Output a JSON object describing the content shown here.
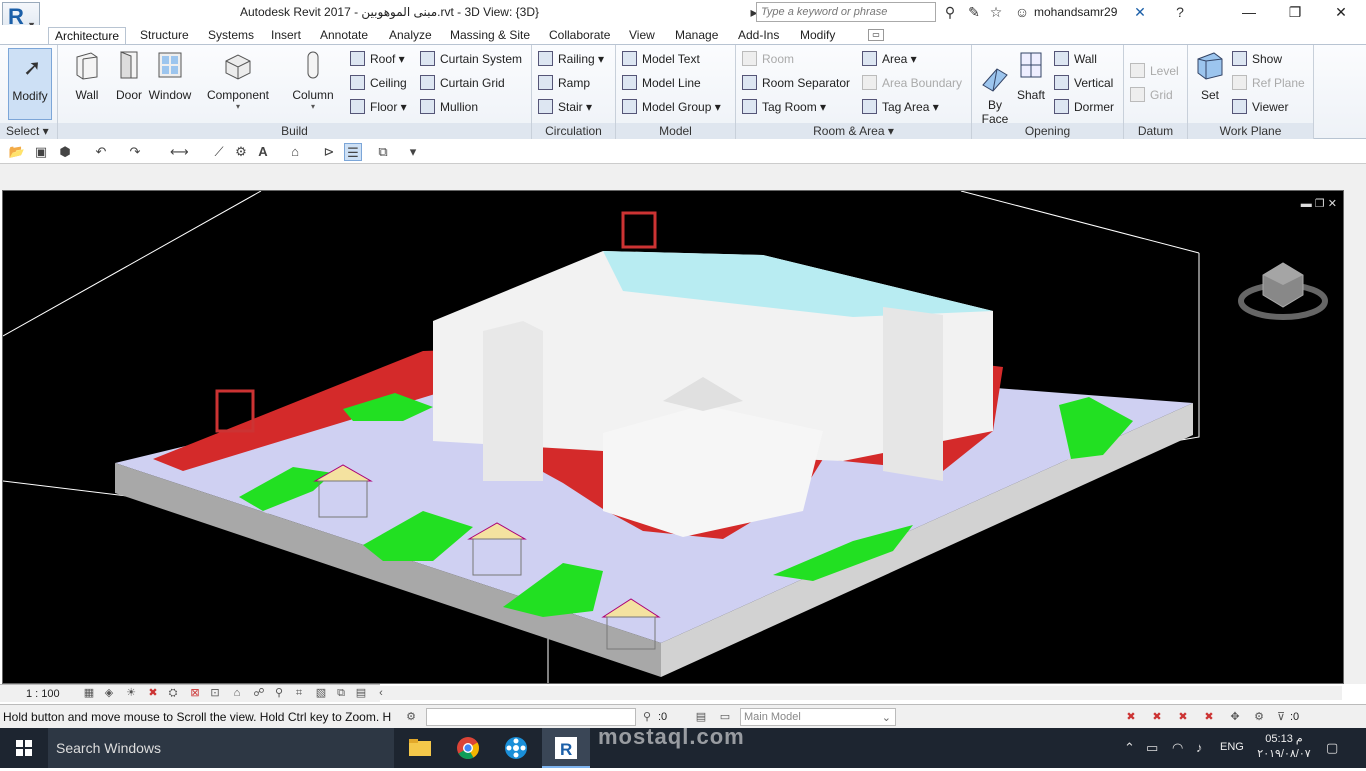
{
  "titlebar": {
    "title": "Autodesk Revit 2017 -     مبنى الموهوبين.rvt - 3D View: {3D}",
    "search_placeholder": "Type a keyword or phrase",
    "user": "mohandsamr29"
  },
  "ribbon_tabs": [
    "Architecture",
    "Structure",
    "Systems",
    "Insert",
    "Annotate",
    "Analyze",
    "Massing & Site",
    "Collaborate",
    "View",
    "Manage",
    "Add-Ins",
    "Modify"
  ],
  "ribbon": {
    "select": {
      "modify": "Modify",
      "label": "Select ▾"
    },
    "build": {
      "label": "Build",
      "big": [
        "Wall",
        "Door",
        "Window",
        "Component",
        "Column"
      ],
      "small": [
        "Roof ▾",
        "Ceiling",
        "Floor ▾",
        "Curtain System",
        "Curtain Grid",
        "Mullion"
      ]
    },
    "circulation": {
      "label": "Circulation",
      "small": [
        "Railing ▾",
        "Ramp",
        "Stair ▾"
      ]
    },
    "model": {
      "label": "Model",
      "small": [
        "Model Text",
        "Model Line",
        "Model Group ▾"
      ]
    },
    "room_area": {
      "label": "Room & Area ▾",
      "small": [
        "Room",
        "Room Separator",
        "Tag Room ▾",
        "Area ▾",
        "Area Boundary",
        "Tag Area ▾"
      ]
    },
    "opening": {
      "label": "Opening",
      "big": [
        "By\nFace",
        "Shaft"
      ],
      "small": [
        "Wall",
        "Vertical",
        "Dormer"
      ]
    },
    "datum": {
      "label": "Datum",
      "small": [
        "Level",
        "Grid"
      ]
    },
    "work_plane": {
      "label": "Work Plane",
      "big": [
        "Set"
      ],
      "small": [
        "Show",
        "Ref Plane",
        "Viewer"
      ]
    }
  },
  "view_bar": {
    "scale": "1 : 100"
  },
  "statusbar": {
    "text": "Hold button and move mouse to Scroll the view. Hold Ctrl key to Zoom. H",
    "zero_a": ":0",
    "model": "Main Model",
    "zero_b": ":0"
  },
  "taskbar": {
    "search": "Search Windows",
    "lang": "ENG",
    "time": "05:13 م",
    "date": "٢٠١٩/٠٨/٠٧"
  },
  "watermark": "mostaql.com"
}
